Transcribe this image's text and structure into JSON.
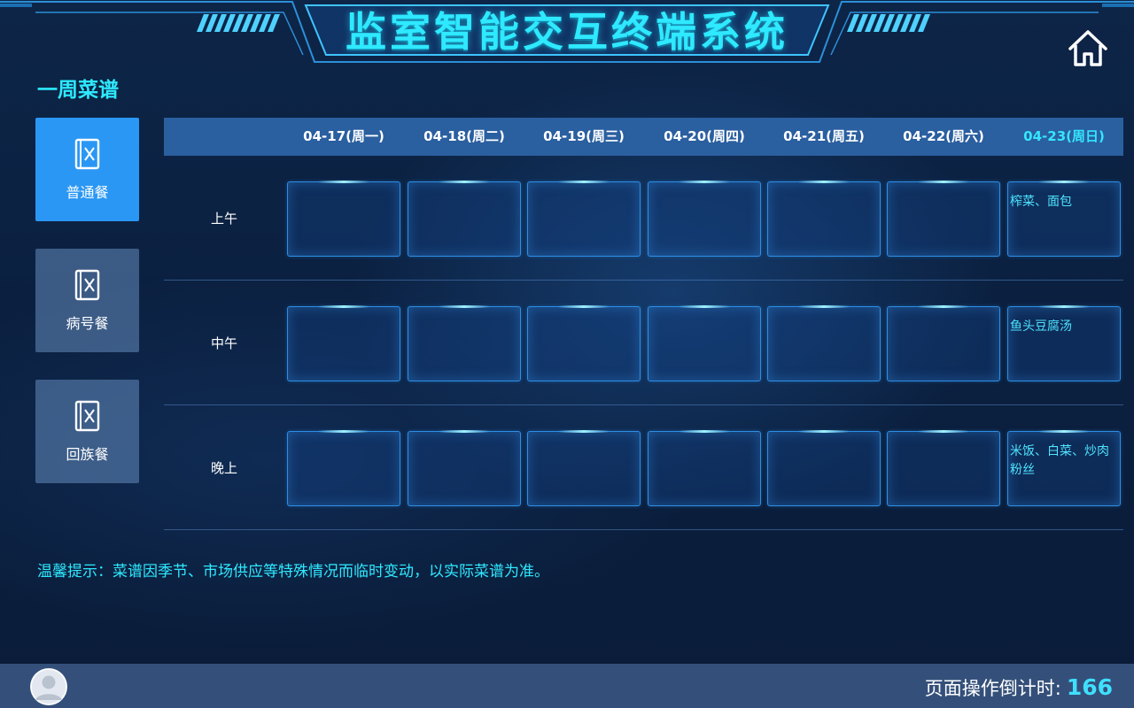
{
  "header": {
    "title": "监室智能交互终端系统",
    "home_icon": "home-icon"
  },
  "section": {
    "title": "一周菜谱"
  },
  "menu": {
    "items": [
      {
        "label": "普通餐",
        "icon": "menu-book-icon",
        "active": true
      },
      {
        "label": "病号餐",
        "icon": "menu-book-icon",
        "active": false
      },
      {
        "label": "回族餐",
        "icon": "menu-book-icon",
        "active": false
      }
    ]
  },
  "table": {
    "days": [
      "04-17(周一)",
      "04-18(周二)",
      "04-19(周三)",
      "04-20(周四)",
      "04-21(周五)",
      "04-22(周六)",
      "04-23(周日)"
    ],
    "today_index": 6,
    "rows": [
      {
        "label": "上午",
        "meals": [
          "",
          "",
          "",
          "",
          "",
          "",
          "榨菜、面包"
        ]
      },
      {
        "label": "中午",
        "meals": [
          "",
          "",
          "",
          "",
          "",
          "",
          "鱼头豆腐汤"
        ]
      },
      {
        "label": "晚上",
        "meals": [
          "",
          "",
          "",
          "",
          "",
          "",
          "米饭、白菜、炒肉粉丝"
        ]
      }
    ]
  },
  "tip": "温馨提示：菜谱因季节、市场供应等特殊情况而临时变动，以实际菜谱为准。",
  "footer": {
    "countdown_label": "页面操作倒计时:",
    "countdown_value": "166",
    "avatar_icon": "user-avatar-icon"
  },
  "colors": {
    "accent": "#2ee9ff",
    "active_menu": "#2a97f4",
    "inactive_menu": "#6b8cbc",
    "table_header": "#2a5fa0",
    "cell_border": "#2d8ee6",
    "footer_bg": "#34507a"
  }
}
